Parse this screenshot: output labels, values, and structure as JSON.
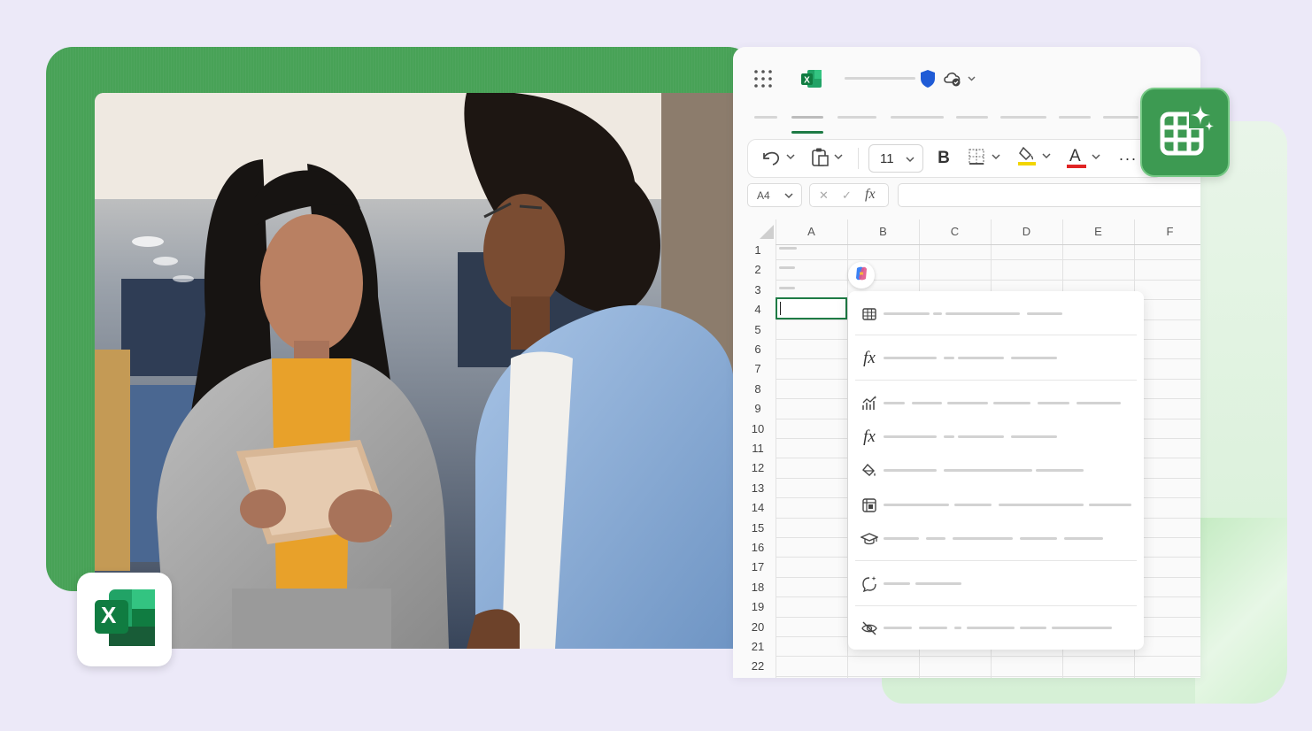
{
  "colors": {
    "background": "#ece9f8",
    "excel_green": "#1e7b45",
    "frame_green": "#48a257",
    "font_color_underline": "#e02424",
    "fill_color_underline": "#f2d500",
    "shield_blue": "#1f5bd6"
  },
  "toolbar": {
    "font_size": "11",
    "bold_label": "B",
    "font_color_label": "A",
    "more_label": "···"
  },
  "formula_bar": {
    "name_box": "A4",
    "fx_label": "fx",
    "cancel_label": "✕",
    "confirm_label": "✓"
  },
  "grid": {
    "columns": [
      "A",
      "B",
      "C",
      "D",
      "E",
      "F"
    ],
    "rows": [
      "1",
      "2",
      "3",
      "4",
      "5",
      "6",
      "7",
      "8",
      "9",
      "10",
      "11",
      "12",
      "13",
      "14",
      "15",
      "16",
      "17",
      "18",
      "19",
      "20",
      "21",
      "22"
    ],
    "active_cell": "A4"
  },
  "copilot_menu": {
    "items": [
      {
        "icon": "table-icon"
      },
      {
        "icon": "function-icon"
      },
      {
        "icon": "chart-insights-icon"
      },
      {
        "icon": "function-icon"
      },
      {
        "icon": "paint-bucket-icon"
      },
      {
        "icon": "pivot-table-icon"
      },
      {
        "icon": "graduation-cap-icon"
      },
      {
        "icon": "chat-sparkle-icon"
      },
      {
        "icon": "eye-off-icon"
      }
    ]
  },
  "badges": {
    "excel_letter": "X"
  },
  "icons": {
    "app_launcher": "waffle-icon",
    "app": "excel-icon",
    "shield": "shield-icon",
    "cloud": "cloud-sync-icon",
    "undo": "undo-icon",
    "paste": "clipboard-icon",
    "borders": "borders-icon",
    "fill": "fill-color-icon",
    "copilot": "copilot-icon",
    "ai_grid": "copilot-grid-sparkle-icon"
  }
}
